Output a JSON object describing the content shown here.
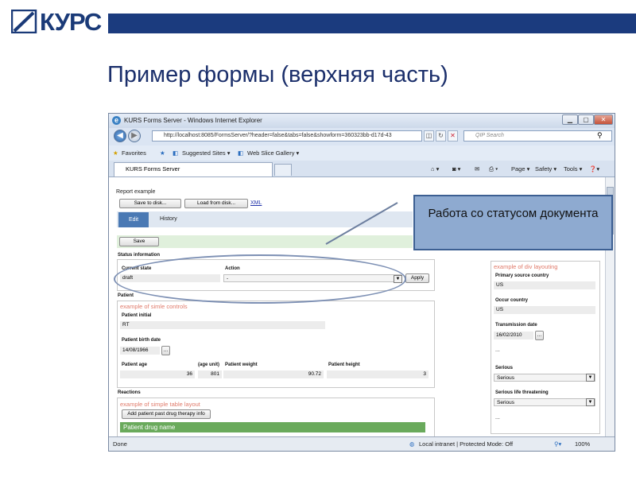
{
  "slide": {
    "logo_text": "КУРС",
    "title": "Пример формы (верхняя часть)",
    "callout": "Работа со статусом документа",
    "colors": {
      "brand": "#1b3b7e",
      "callout_bg": "#8eaad0",
      "tab_bg": "#4a79b4",
      "grid_header": "#6aaa5c"
    }
  },
  "browser": {
    "window_title": "KURS Forms Server - Windows Internet Explorer",
    "address": "http://localhost:8085/FormsServer/?header=false&tabs=false&showform=360323bb-d17d-43",
    "search_placeholder": "QIP Search",
    "favorites_label": "Favorites",
    "suggested_sites": "Suggested Sites ▾",
    "web_slice": "Web Slice Gallery ▾",
    "tab_title": "KURS Forms Server",
    "cmd_page": "Page ▾",
    "cmd_safety": "Safety ▾",
    "cmd_tools": "Tools ▾",
    "cmd_help": "❓▾",
    "status_left": "Done",
    "status_zone": "Local intranet | Protected Mode: Off",
    "zoom": "100%"
  },
  "form": {
    "report_title": "Report example",
    "save_to_disk": "Save to disk...",
    "load_from_disk": "Load from disk...",
    "xml_link": "XML",
    "tab_edit": "Edit",
    "tab_history": "History",
    "save_button": "Save",
    "status_information": "Status information",
    "current_state_label": "Current state",
    "current_state_value": "draft",
    "action_label": "Action",
    "action_value": "-",
    "apply_button": "Apply",
    "patient_label": "Patient",
    "simple_controls_title": "example of simle controls",
    "patient_initial_label": "Patient initial",
    "patient_initial_value": "RT",
    "birth_date_label": "Patient birth date",
    "birth_date_value": "14/08/1966",
    "age_label": "Patient age",
    "age_value": "36",
    "age_unit_label": "(age unit)",
    "age_unit_value": "801",
    "weight_label": "Patient weight",
    "weight_value": "90.72",
    "height_label": "Patient height",
    "height_value": "3",
    "reactions_label": "Reactions",
    "table_layout_title": "example of simple table layout",
    "add_drug_button": "Add patient past drug therapy info",
    "drug_grid_header": "Patient drug name",
    "div_layout_title": "example of div layouting",
    "primary_source_label": "Primary source country",
    "primary_source_value": "US",
    "occur_country_label": "Occur country",
    "occur_country_value": "US",
    "transmission_date_label": "Transmission date",
    "transmission_date_value": "16/02/2010",
    "ellipsis1": "...",
    "serious_label": "Serious",
    "serious_value": "Serious",
    "serious_life_label": "Serious life threatening",
    "serious_life_value": "Serious",
    "ellipsis2": "..."
  }
}
